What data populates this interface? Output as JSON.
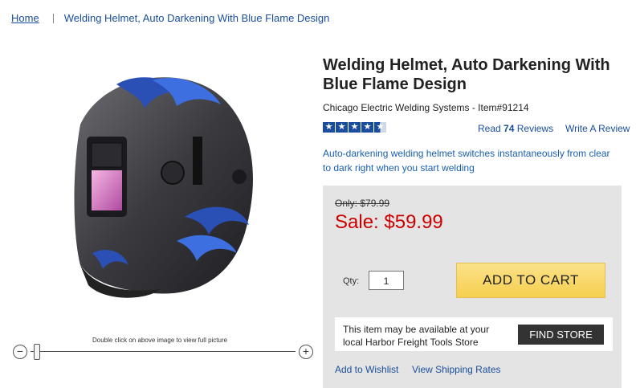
{
  "breadcrumb": {
    "home": "Home",
    "current": "Welding Helmet, Auto Darkening With Blue Flame Design"
  },
  "product": {
    "title": "Welding Helmet, Auto Darkening With Blue Flame Design",
    "brand_item": "Chicago Electric Welding Systems - Item#91214",
    "rating": 4.5,
    "reviews_prefix": "Read",
    "reviews_count": "74",
    "reviews_suffix": "Reviews",
    "write_review": "Write A Review",
    "description": "Auto-darkening welding helmet switches instantaneously from clear to dark right when you start welding",
    "image_caption": "Double click on above image to view full picture"
  },
  "pricing": {
    "was": "Only: $79.99",
    "sale": "Sale: $59.99"
  },
  "cart": {
    "qty_label": "Qty:",
    "qty_value": "1",
    "add_to_cart": "ADD TO CART"
  },
  "store": {
    "text": "This item may be available at your local Harbor Freight Tools Store",
    "find_store": "FIND STORE"
  },
  "links": {
    "wishlist": "Add to Wishlist",
    "shipping": "View Shipping Rates"
  },
  "zoom": {
    "level": 0.02
  },
  "colors": {
    "link": "#1a4e9c",
    "sale": "#cc0000",
    "cart_button": "#f6cf4f"
  }
}
